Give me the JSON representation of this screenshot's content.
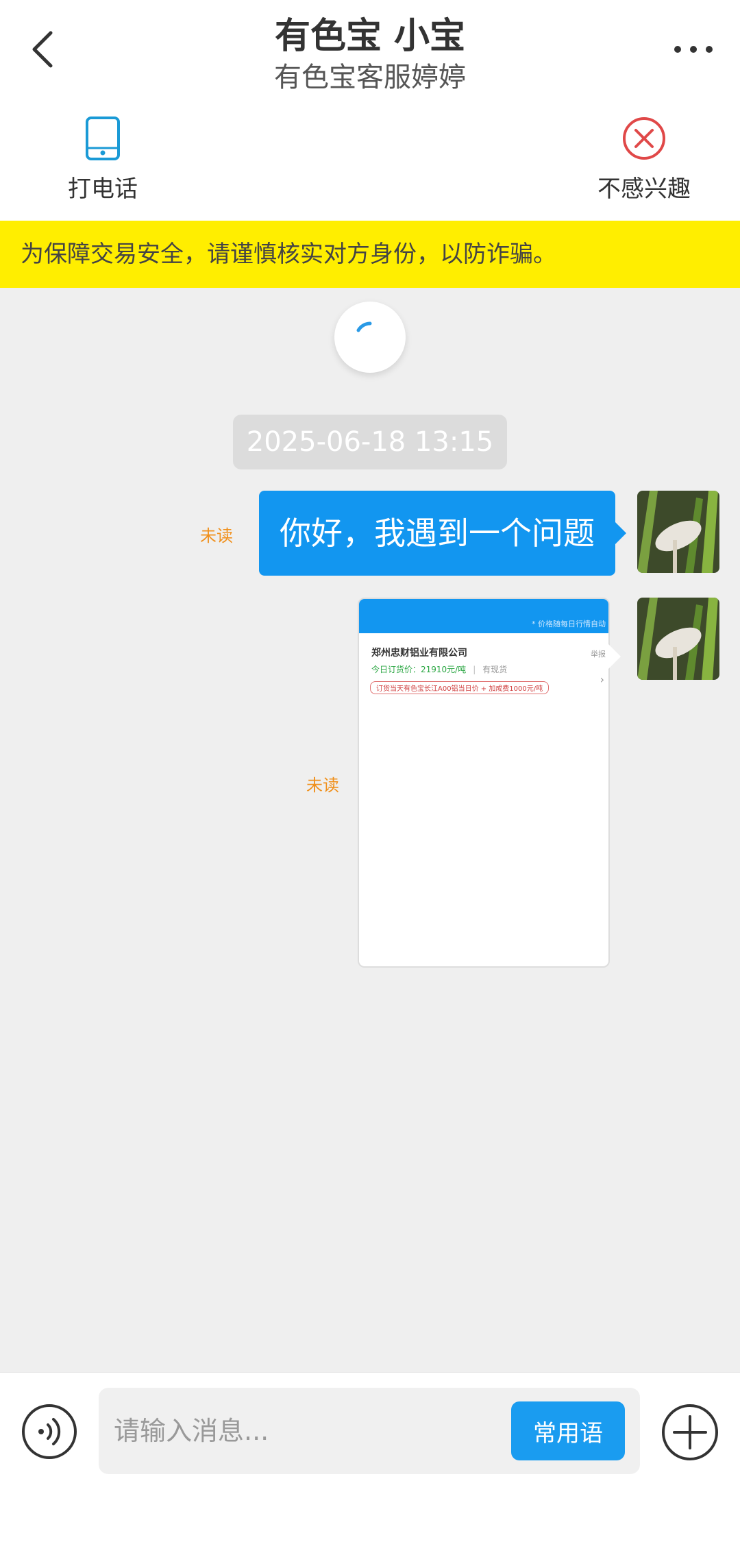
{
  "header": {
    "title": "有色宝 小宝",
    "subtitle": "有色宝客服婷婷",
    "back_icon": "chevron-left-icon",
    "more_icon": "more-horizontal-icon"
  },
  "actions": {
    "call_label": "打电话",
    "call_icon": "phone-icon",
    "ignore_label": "不感兴趣",
    "ignore_icon": "close-circle-icon"
  },
  "banner": {
    "text": "为保障交易安全，请谨慎核实对方身份，以防诈骗。"
  },
  "chat": {
    "timestamp": "2025-06-18 13:15",
    "messages": [
      {
        "type": "text",
        "text": "你好，我遇到一个问题",
        "status": "未读"
      },
      {
        "type": "card",
        "status": "未读",
        "card": {
          "top_note": "* 价格随每日行情自动",
          "company": "郑州忠财铝业有限公司",
          "report": "举报",
          "price_line": "今日订货价：21910元/吨",
          "separator": "|",
          "spot": "有现货",
          "tag": "订货当天有色宝长江A00铝当日价 + 加成费1000元/吨"
        }
      }
    ]
  },
  "input": {
    "placeholder": "请输入消息...",
    "phrases_label": "常用语",
    "voice_icon": "voice-icon",
    "plus_icon": "plus-circle-icon"
  },
  "colors": {
    "accent": "#1296f0",
    "banner_bg": "#ffee00",
    "unread": "#f0901c",
    "ignore_red": "#e04848"
  }
}
